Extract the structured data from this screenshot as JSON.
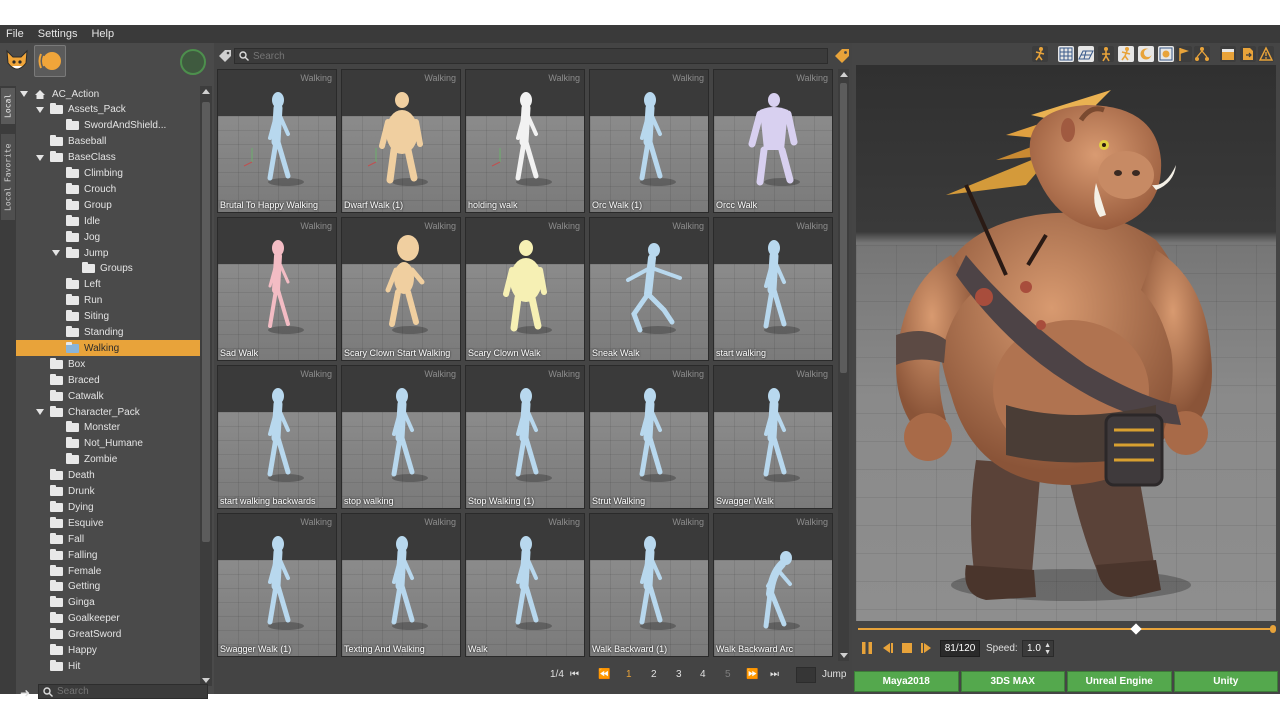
{
  "menu": [
    "File",
    "Settings",
    "Help"
  ],
  "side_tabs": {
    "local": "Local",
    "favorites": "Local Favorite"
  },
  "tree": [
    {
      "label": "AC_Action",
      "indent": 0,
      "expanded": true,
      "icon": "home-icon"
    },
    {
      "label": "Assets_Pack",
      "indent": 1,
      "expanded": true
    },
    {
      "label": "SwordAndShield...",
      "indent": 2
    },
    {
      "label": "Baseball",
      "indent": 1
    },
    {
      "label": "BaseClass",
      "indent": 1,
      "expanded": true
    },
    {
      "label": "Climbing",
      "indent": 2
    },
    {
      "label": "Crouch",
      "indent": 2
    },
    {
      "label": "Group",
      "indent": 2
    },
    {
      "label": "Idle",
      "indent": 2
    },
    {
      "label": "Jog",
      "indent": 2
    },
    {
      "label": "Jump",
      "indent": 2,
      "expanded": true
    },
    {
      "label": "Groups",
      "indent": 3
    },
    {
      "label": "Left",
      "indent": 2
    },
    {
      "label": "Run",
      "indent": 2
    },
    {
      "label": "Siting",
      "indent": 2
    },
    {
      "label": "Standing",
      "indent": 2
    },
    {
      "label": "Walking",
      "indent": 2,
      "selected": true
    },
    {
      "label": "Box",
      "indent": 1
    },
    {
      "label": "Braced",
      "indent": 1
    },
    {
      "label": "Catwalk",
      "indent": 1
    },
    {
      "label": "Character_Pack",
      "indent": 1,
      "expanded": true
    },
    {
      "label": "Monster",
      "indent": 2
    },
    {
      "label": "Not_Humane",
      "indent": 2
    },
    {
      "label": "Zombie",
      "indent": 2
    },
    {
      "label": "Death",
      "indent": 1
    },
    {
      "label": "Drunk",
      "indent": 1
    },
    {
      "label": "Dying",
      "indent": 1
    },
    {
      "label": "Esquive",
      "indent": 1
    },
    {
      "label": "Fall",
      "indent": 1
    },
    {
      "label": "Falling",
      "indent": 1
    },
    {
      "label": "Female",
      "indent": 1
    },
    {
      "label": "Getting",
      "indent": 1
    },
    {
      "label": "Ginga",
      "indent": 1
    },
    {
      "label": "Goalkeeper",
      "indent": 1
    },
    {
      "label": "GreatSword",
      "indent": 1
    },
    {
      "label": "Happy",
      "indent": 1
    },
    {
      "label": "Hit",
      "indent": 1
    }
  ],
  "left_search": {
    "placeholder": "Search"
  },
  "grid_search": {
    "placeholder": "Search"
  },
  "cards": [
    {
      "caption": "Brutal To Happy Walking",
      "tag": "Walking",
      "figure": "#b8d8ee",
      "pose": "walk",
      "axes": true
    },
    {
      "caption": "Dwarf Walk (1)",
      "tag": "Walking",
      "figure": "#f0cfa0",
      "pose": "fat",
      "axes": true
    },
    {
      "caption": "holding walk",
      "tag": "Walking",
      "figure": "#f2f2f2",
      "pose": "walk",
      "axes": true
    },
    {
      "caption": "Orc Walk (1)",
      "tag": "Walking",
      "figure": "#b8d8ee",
      "pose": "walk",
      "axes": false
    },
    {
      "caption": "Orcc Walk",
      "tag": "Walking",
      "figure": "#d8d0f0",
      "pose": "bulky",
      "axes": false
    },
    {
      "caption": "Sad Walk",
      "tag": "Walking",
      "figure": "#f3bcc4",
      "pose": "slim",
      "axes": false
    },
    {
      "caption": "Scary Clown Start Walking",
      "tag": "Walking",
      "figure": "#f0cfa0",
      "pose": "bighead",
      "axes": false
    },
    {
      "caption": "Scary Clown Walk",
      "tag": "Walking",
      "figure": "#f6f0b4",
      "pose": "fat",
      "axes": false
    },
    {
      "caption": "Sneak Walk",
      "tag": "Walking",
      "figure": "#b8d8ee",
      "pose": "sneak",
      "axes": false
    },
    {
      "caption": "start walking",
      "tag": "Walking",
      "figure": "#b8d8ee",
      "pose": "walk",
      "axes": false
    },
    {
      "caption": "start walking backwards",
      "tag": "Walking",
      "figure": "#b8d8ee",
      "pose": "walk",
      "axes": false
    },
    {
      "caption": "stop walking",
      "tag": "Walking",
      "figure": "#b8d8ee",
      "pose": "walk",
      "axes": false
    },
    {
      "caption": "Stop Walking (1)",
      "tag": "Walking",
      "figure": "#b8d8ee",
      "pose": "walk",
      "axes": false
    },
    {
      "caption": "Strut Walking",
      "tag": "Walking",
      "figure": "#b8d8ee",
      "pose": "walk",
      "axes": false
    },
    {
      "caption": "Swagger Walk",
      "tag": "Walking",
      "figure": "#b8d8ee",
      "pose": "walk",
      "axes": false
    },
    {
      "caption": "Swagger Walk (1)",
      "tag": "Walking",
      "figure": "#b8d8ee",
      "pose": "walk",
      "axes": false
    },
    {
      "caption": "Texting And Walking",
      "tag": "Walking",
      "figure": "#b8d8ee",
      "pose": "walk",
      "axes": false
    },
    {
      "caption": "Walk",
      "tag": "Walking",
      "figure": "#b8d8ee",
      "pose": "walk",
      "axes": false
    },
    {
      "caption": "Walk Backward (1)",
      "tag": "Walking",
      "figure": "#b8d8ee",
      "pose": "walk",
      "axes": false
    },
    {
      "caption": "Walk Backward Arc",
      "tag": "Walking",
      "figure": "#b8d8ee",
      "pose": "hunch",
      "axes": false
    }
  ],
  "pager": {
    "current": "1/4",
    "pages": [
      "1",
      "2",
      "3",
      "4",
      "5"
    ],
    "active": "1",
    "jump_label": "Jump"
  },
  "viewer": {
    "frame": "81/120",
    "speed_label": "Speed:",
    "speed_value": "1.0",
    "progress": 0.675
  },
  "exports": [
    "Maya2018",
    "3DS MAX",
    "Unreal Engine",
    "Unity"
  ],
  "colors": {
    "accent": "#e8a33a",
    "export": "#54a84d",
    "panel": "#444444"
  }
}
